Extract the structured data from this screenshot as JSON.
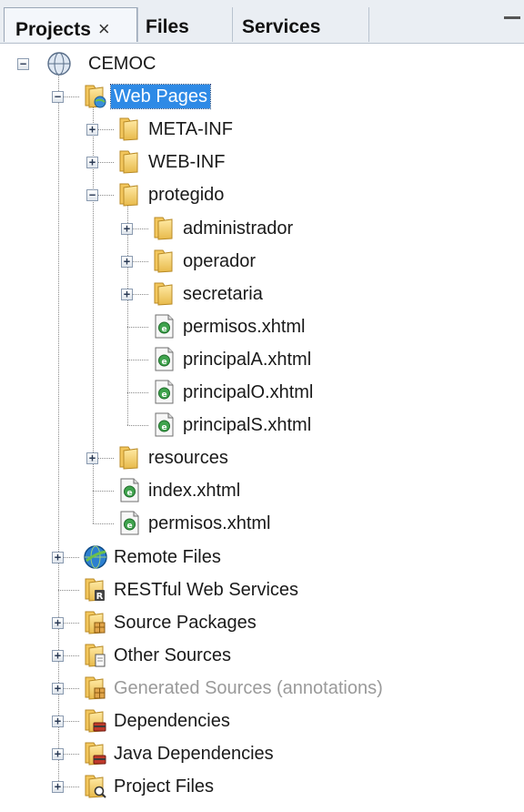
{
  "tabs": [
    {
      "label": "Projects",
      "close": "×",
      "active": true
    },
    {
      "label": "Files",
      "active": false
    },
    {
      "label": "Services",
      "active": false
    }
  ],
  "tree": [
    {
      "label": "CEMOC",
      "icon": "web-globe-icon",
      "toggle": "−"
    },
    {
      "label": "Web Pages",
      "icon": "web-pages-folder-icon",
      "toggle": "−",
      "selected": true
    },
    {
      "label": "META-INF",
      "icon": "folder-icon",
      "toggle": "+"
    },
    {
      "label": "WEB-INF",
      "icon": "folder-icon",
      "toggle": "+"
    },
    {
      "label": "protegido",
      "icon": "folder-icon",
      "toggle": "−"
    },
    {
      "label": "administrador",
      "icon": "folder-icon",
      "toggle": "+"
    },
    {
      "label": "operador",
      "icon": "folder-icon",
      "toggle": "+"
    },
    {
      "label": "secretaria",
      "icon": "folder-icon",
      "toggle": "+"
    },
    {
      "label": "permisos.xhtml",
      "icon": "xhtml-file-icon"
    },
    {
      "label": "principalA.xhtml",
      "icon": "xhtml-file-icon"
    },
    {
      "label": "principalO.xhtml",
      "icon": "xhtml-file-icon"
    },
    {
      "label": "principalS.xhtml",
      "icon": "xhtml-file-icon"
    },
    {
      "label": "resources",
      "icon": "folder-icon",
      "toggle": "+"
    },
    {
      "label": "index.xhtml",
      "icon": "xhtml-file-icon"
    },
    {
      "label": "permisos.xhtml",
      "icon": "xhtml-file-icon"
    },
    {
      "label": "Remote Files",
      "icon": "remote-globe-icon",
      "toggle": "+"
    },
    {
      "label": "RESTful Web Services",
      "icon": "rest-services-folder-icon"
    },
    {
      "label": "Source Packages",
      "icon": "source-packages-folder-icon",
      "toggle": "+"
    },
    {
      "label": "Other Sources",
      "icon": "other-sources-folder-icon",
      "toggle": "+"
    },
    {
      "label": "Generated Sources (annotations)",
      "icon": "generated-sources-folder-icon",
      "toggle": "+",
      "dim": true
    },
    {
      "label": "Dependencies",
      "icon": "dependencies-folder-icon",
      "toggle": "+"
    },
    {
      "label": "Java Dependencies",
      "icon": "java-dependencies-folder-icon",
      "toggle": "+"
    },
    {
      "label": "Project Files",
      "icon": "project-files-folder-icon",
      "toggle": "+"
    }
  ]
}
